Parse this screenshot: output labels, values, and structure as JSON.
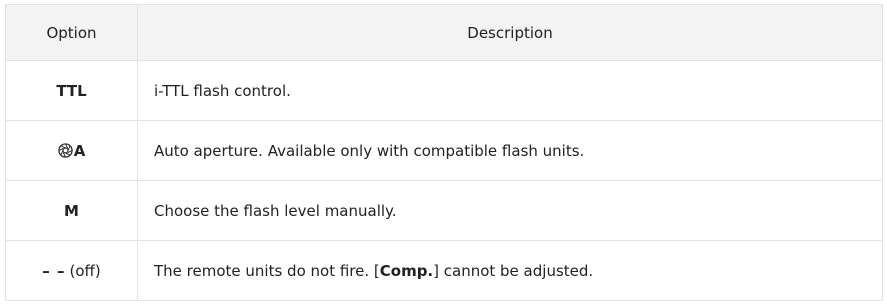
{
  "table": {
    "headers": {
      "option": "Option",
      "description": "Description"
    },
    "rows": [
      {
        "option": "TTL",
        "description": "i-TTL flash control."
      },
      {
        "option_icon": "aperture-icon",
        "option": "A",
        "description": "Auto aperture. Available only with compatible flash units."
      },
      {
        "option": "M",
        "description": "Choose the flash level manually."
      },
      {
        "option_dash": "– –",
        "option_suffix": "(off)",
        "description_before": "The remote units do not fire. [",
        "description_bold": "Comp.",
        "description_after": "] cannot be adjusted."
      }
    ]
  }
}
